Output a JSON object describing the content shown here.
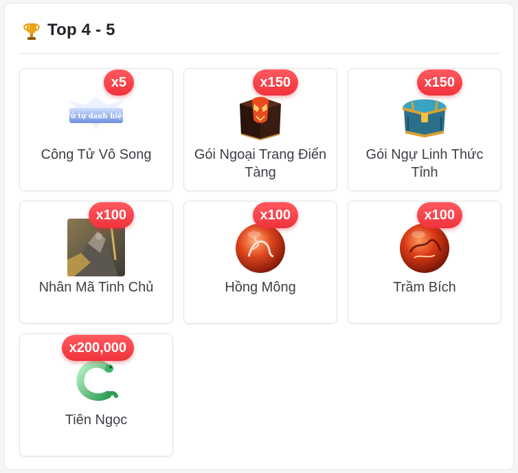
{
  "section": {
    "title": "Top 4 - 5",
    "icon": "trophy-icon"
  },
  "rewards": [
    {
      "name": "Công Tử Vô Song",
      "quantity": "x5",
      "icon": "title-banner-icon",
      "banner_text": "Tử tự danh hiệu"
    },
    {
      "name": "Gói Ngoại Trang Điển Tàng",
      "quantity": "x150",
      "icon": "costume-chest-icon"
    },
    {
      "name": "Gói Ngự Linh Thức Tỉnh",
      "quantity": "x150",
      "icon": "treasure-chest-icon"
    },
    {
      "name": "Nhân Mã Tinh Chủ",
      "quantity": "x100",
      "icon": "centaur-portrait-icon"
    },
    {
      "name": "Hồng Mông",
      "quantity": "x100",
      "icon": "red-orb-icon"
    },
    {
      "name": "Trầm Bích",
      "quantity": "x100",
      "icon": "red-orb-icon"
    },
    {
      "name": "Tiên Ngọc",
      "quantity": "x200,000",
      "icon": "jade-serpent-icon"
    }
  ],
  "colors": {
    "badge": "#f0323c",
    "title_text": "#1f2328",
    "name_text": "#3b3f45",
    "card_border": "#dfe1e5"
  }
}
